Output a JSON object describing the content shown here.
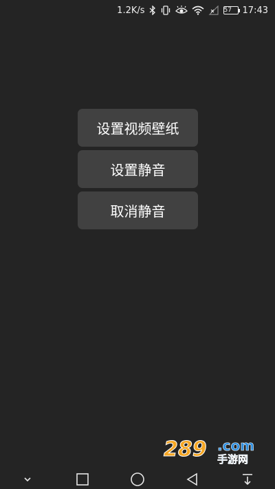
{
  "status_bar": {
    "network_speed": "1.2K/s",
    "battery_level": "57",
    "time": "17:43",
    "icons": [
      "bluetooth-icon",
      "vibrate-icon",
      "eye-comfort-icon",
      "wifi-icon",
      "no-signal-icon"
    ]
  },
  "menu": {
    "items": [
      {
        "label": "设置视频壁纸"
      },
      {
        "label": "设置静音"
      },
      {
        "label": "取消静音"
      }
    ]
  },
  "watermark": {
    "brand": "289",
    "suffix": ".com",
    "tagline": "手游网"
  },
  "nav_bar": {
    "icons": [
      "collapse-chevron-icon",
      "recents-square-icon",
      "home-circle-icon",
      "back-triangle-icon",
      "notification-pull-icon"
    ]
  },
  "colors": {
    "background": "#242424",
    "button": "#414141",
    "text": "#ffffff",
    "watermark_orange": "#f5a623",
    "watermark_blue": "#2b8de0"
  }
}
